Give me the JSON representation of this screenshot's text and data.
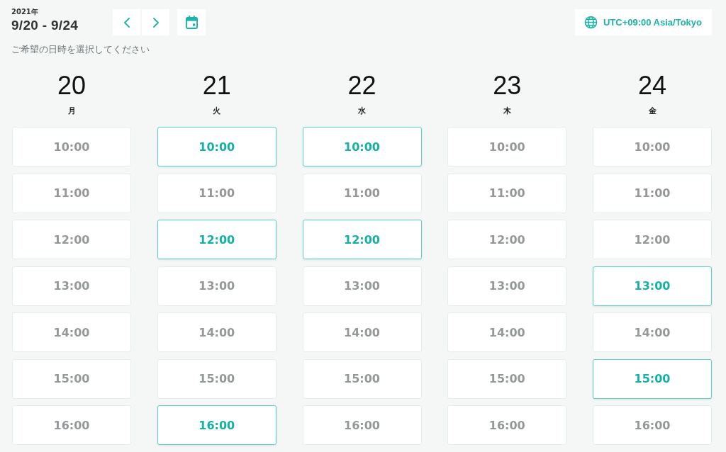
{
  "header": {
    "year": "2021年",
    "date_range": "9/20 - 9/24",
    "timezone": "UTC+09:00 Asia/Tokyo"
  },
  "instruction": "ご希望の日時を選択してください",
  "days": [
    {
      "date": "20",
      "weekday": "月",
      "slots": [
        {
          "time": "10:00",
          "available": false
        },
        {
          "time": "11:00",
          "available": false
        },
        {
          "time": "12:00",
          "available": false
        },
        {
          "time": "13:00",
          "available": false
        },
        {
          "time": "14:00",
          "available": false
        },
        {
          "time": "15:00",
          "available": false
        },
        {
          "time": "16:00",
          "available": false
        }
      ]
    },
    {
      "date": "21",
      "weekday": "火",
      "slots": [
        {
          "time": "10:00",
          "available": true
        },
        {
          "time": "11:00",
          "available": false
        },
        {
          "time": "12:00",
          "available": true
        },
        {
          "time": "13:00",
          "available": false
        },
        {
          "time": "14:00",
          "available": false
        },
        {
          "time": "15:00",
          "available": false
        },
        {
          "time": "16:00",
          "available": true
        }
      ]
    },
    {
      "date": "22",
      "weekday": "水",
      "slots": [
        {
          "time": "10:00",
          "available": true
        },
        {
          "time": "11:00",
          "available": false
        },
        {
          "time": "12:00",
          "available": true
        },
        {
          "time": "13:00",
          "available": false
        },
        {
          "time": "14:00",
          "available": false
        },
        {
          "time": "15:00",
          "available": false
        },
        {
          "time": "16:00",
          "available": false
        }
      ]
    },
    {
      "date": "23",
      "weekday": "木",
      "slots": [
        {
          "time": "10:00",
          "available": false
        },
        {
          "time": "11:00",
          "available": false
        },
        {
          "time": "12:00",
          "available": false
        },
        {
          "time": "13:00",
          "available": false
        },
        {
          "time": "14:00",
          "available": false
        },
        {
          "time": "15:00",
          "available": false
        },
        {
          "time": "16:00",
          "available": false
        }
      ]
    },
    {
      "date": "24",
      "weekday": "金",
      "slots": [
        {
          "time": "10:00",
          "available": false
        },
        {
          "time": "11:00",
          "available": false
        },
        {
          "time": "12:00",
          "available": false
        },
        {
          "time": "13:00",
          "available": true
        },
        {
          "time": "14:00",
          "available": false
        },
        {
          "time": "15:00",
          "available": true
        },
        {
          "time": "16:00",
          "available": false
        }
      ]
    }
  ]
}
